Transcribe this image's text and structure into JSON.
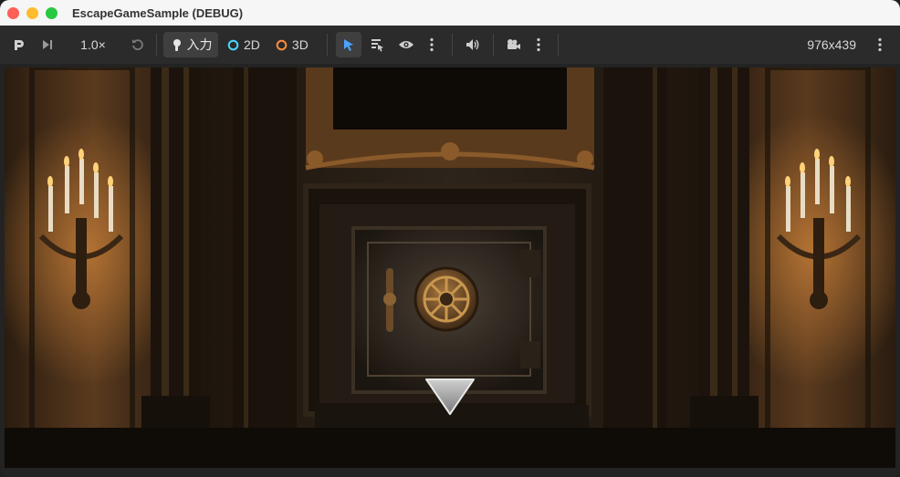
{
  "window": {
    "title": "EscapeGameSample (DEBUG)",
    "traffic_colors": {
      "close": "#fe5f57",
      "minimize": "#febc2e",
      "maximize": "#28c840"
    }
  },
  "toolbar": {
    "speed_label": "1.0×",
    "input_label": "入力",
    "mode_2d_label": "2D",
    "mode_3d_label": "3D",
    "resolution_label": "976x439",
    "icons": [
      "embed-icon",
      "step-frame-icon",
      "reset-icon",
      "input-icon",
      "cursor-select-icon",
      "list-select-icon",
      "eye-icon",
      "kebab-icon",
      "speaker-icon",
      "camera-icon",
      "kebab-icon",
      "kebab-icon"
    ],
    "colors": {
      "accent_blue": "#4aa3ff",
      "mode_2d": "#4ad6ff",
      "mode_3d": "#ff8c3a",
      "active_bg": "#3f3f3f"
    }
  },
  "game": {
    "scene": "vault-room",
    "navigation": {
      "icon": "triangle-down-icon"
    }
  }
}
